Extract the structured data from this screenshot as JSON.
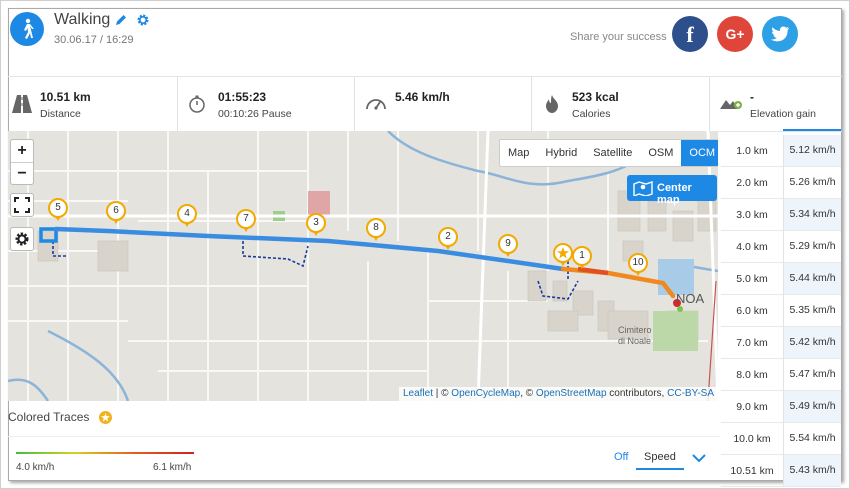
{
  "header": {
    "title": "Walking",
    "datetime": "30.06.17 / 16:29",
    "share_text": "Share your success",
    "social": {
      "facebook": "f",
      "google": "G+"
    }
  },
  "stats": [
    {
      "icon": "road-icon",
      "value": "10.51 km",
      "label": "Distance"
    },
    {
      "icon": "stopwatch-icon",
      "value": "01:55:23",
      "label": "00:10:26 Pause"
    },
    {
      "icon": "speedometer-icon",
      "value": "5.46 km/h",
      "label": ""
    },
    {
      "icon": "flame-icon",
      "value": "523 kcal",
      "label": "Calories"
    },
    {
      "icon": "elevation-icon",
      "value": "-",
      "label": "Elevation gain"
    }
  ],
  "map": {
    "zoom_in": "+",
    "zoom_out": "−",
    "layers": [
      "Map",
      "Hybrid",
      "Satellite",
      "OSM",
      "OCM"
    ],
    "active_layer": "OCM",
    "center_button": "Center map",
    "place_label": "Cimitero di Noale",
    "place_label_line1": "Cimitero",
    "place_label_line2": "di Noale",
    "town_label": "NOA",
    "attribution": {
      "leaflet": "Leaflet",
      "sep1": " | © ",
      "ocm": "OpenCycleMap",
      "sep2": ", © ",
      "osm": "OpenStreetMap",
      "contrib": " contributors, ",
      "license": "CC-BY-SA"
    },
    "markers": [
      "1",
      "2",
      "3",
      "4",
      "5",
      "6",
      "7",
      "8",
      "9",
      "10"
    ]
  },
  "splits": [
    {
      "km": "1.0 km",
      "speed": "5.12 km/h"
    },
    {
      "km": "2.0 km",
      "speed": "5.26 km/h"
    },
    {
      "km": "3.0 km",
      "speed": "5.34 km/h"
    },
    {
      "km": "4.0 km",
      "speed": "5.29 km/h"
    },
    {
      "km": "5.0 km",
      "speed": "5.44 km/h"
    },
    {
      "km": "6.0 km",
      "speed": "5.35 km/h"
    },
    {
      "km": "7.0 km",
      "speed": "5.42 km/h"
    },
    {
      "km": "8.0 km",
      "speed": "5.47 km/h"
    },
    {
      "km": "9.0 km",
      "speed": "5.49 km/h"
    },
    {
      "km": "10.0 km",
      "speed": "5.54 km/h"
    },
    {
      "km": "10.51 km",
      "speed": "5.43 km/h"
    }
  ],
  "traces": {
    "title": "Colored Traces",
    "min": "4.0 km/h",
    "max": "6.1 km/h",
    "off": "Off",
    "selected": "Speed"
  },
  "colors": {
    "accent": "#1e88e5",
    "route": "#1e88e5",
    "marker": "#f2a900",
    "facebook": "#2d4f8c",
    "google": "#e0453a",
    "twitter": "#2ea0e6"
  }
}
